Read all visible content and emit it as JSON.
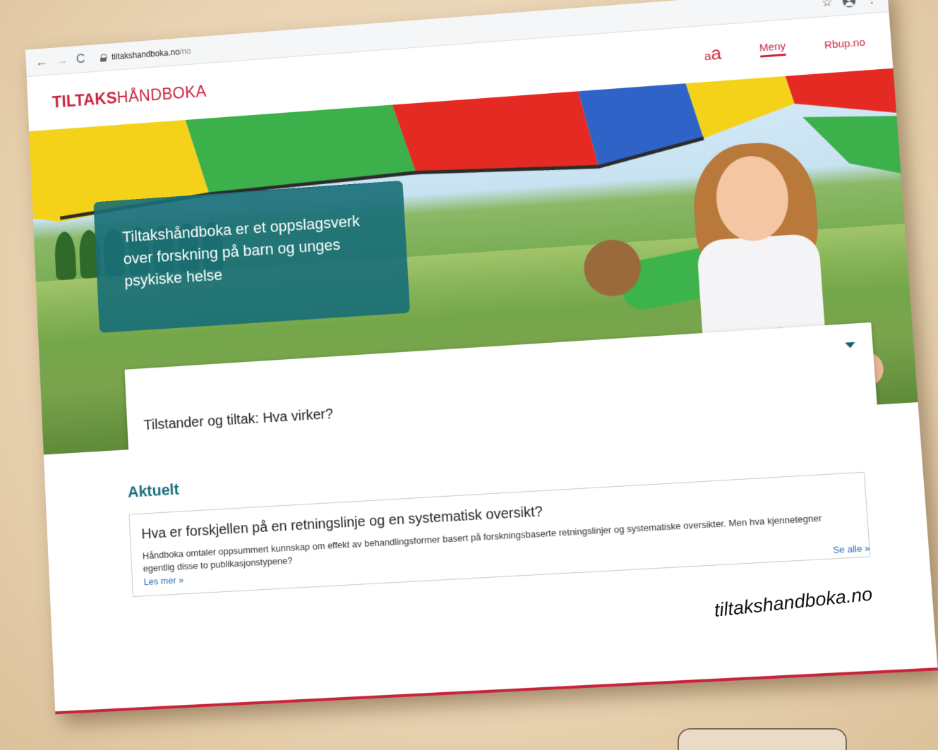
{
  "browser": {
    "url_domain": "tiltakshandboka.no",
    "url_path": "/no",
    "back": "←",
    "forward": "→",
    "reload": "C",
    "star": "☆",
    "more": "⋮"
  },
  "header": {
    "logo_bold": "TILTAKS",
    "logo_light": "HÅNDBOKA",
    "font_size_small": "a",
    "font_size_large": "a",
    "menu_label": "Meny",
    "rbup_label": "Rbup.no"
  },
  "hero": {
    "tagline": "Tiltakshåndboka er et oppslagsverk over forskning på barn og unges psykiske helse",
    "select_label": "Tilstander og tiltak: Hva virker?"
  },
  "news": {
    "heading": "Aktuelt",
    "card_title": "Hva er forskjellen på en retningslinje og en systematisk oversikt?",
    "card_body": "Håndboka omtaler oppsummert kunnskap om effekt av behandlingsformer basert på forskningsbaserte retningslinjer og systematiske oversikter. Men hva kjennetegner egentlig disse to publikasjonstypene?",
    "read_more": "Les mer »",
    "see_all": "Se alle »"
  },
  "watermark": "tiltakshandboka.no",
  "colors": {
    "brand_red": "#c8233c",
    "teal": "#1a6e7c",
    "link_blue": "#2a6ab8"
  }
}
